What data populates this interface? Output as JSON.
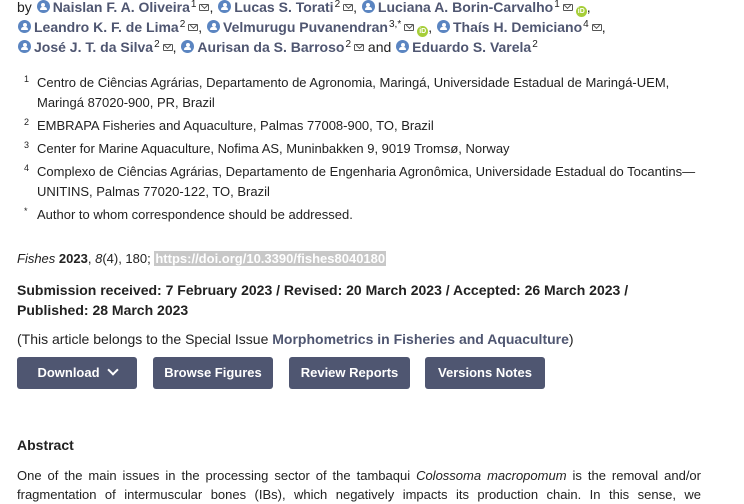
{
  "authors": {
    "by": "by",
    "list": [
      {
        "name": "Naislan F. A. Oliveira",
        "sup": "1"
      },
      {
        "name": "Lucas S. Torati",
        "sup": "2"
      },
      {
        "name": "Luciana A. Borin-Carvalho",
        "sup": "1"
      },
      {
        "name": "Leandro K. F. de Lima",
        "sup": "2"
      },
      {
        "name": "Velmurugu Puvanendran",
        "sup": "3,*"
      },
      {
        "name": "Thaís H. Demiciano",
        "sup": "4"
      },
      {
        "name": "José J. T. da Silva",
        "sup": "2"
      },
      {
        "name": "Aurisan da S. Barroso",
        "sup": "2"
      },
      {
        "name": "Eduardo S. Varela",
        "sup": "2"
      }
    ],
    "and": "and",
    "orcid_text": "iD"
  },
  "affiliations": [
    {
      "num": "1",
      "text": "Centro de Ciências Agrárias, Departamento de Agronomia, Maringá, Universidade Estadual de Maringá-UEM, Maringá 87020-900, PR, Brazil"
    },
    {
      "num": "2",
      "text": "EMBRAPA Fisheries and Aquaculture, Palmas 77008-900, TO, Brazil"
    },
    {
      "num": "3",
      "text": "Center for Marine Aquaculture, Nofima AS, Muninbakken 9, 9019 Tromsø, Norway"
    },
    {
      "num": "4",
      "text": "Complexo de Ciências Agrárias, Departamento de Engenharia Agronômica, Universidade Estadual do Tocantins—UNITINS, Palmas 77020-122, TO, Brazil"
    },
    {
      "num": "*",
      "text": "Author to whom correspondence should be addressed."
    }
  ],
  "citation": {
    "journal": "Fishes",
    "year": "2023",
    "volume": "8",
    "issue_pages": "(4), 180;",
    "doi": "https://doi.org/10.3390/fishes8040180"
  },
  "dates": {
    "line1": "Submission received: 7 February 2023 / Revised: 20 March 2023 / Accepted: 26 March 2023 /",
    "line2": "Published: 28 March 2023"
  },
  "special_issue": {
    "prefix": "(This article belongs to the Special Issue ",
    "link": "Morphometrics in Fisheries and Aquaculture",
    "suffix": ")"
  },
  "buttons": {
    "download": "Download",
    "browse_figures": "Browse Figures",
    "review_reports": "Review Reports",
    "versions_notes": "Versions Notes"
  },
  "abstract": {
    "title": "Abstract",
    "line1_pre": "One of the main issues in the processing sector of the tambaqui ",
    "line1_species": "Colossoma macropomum",
    "line1_post": " is the removal and/or",
    "line2": "fragmentation of intermuscular bones (IBs), which negatively impacts its production chain. In this sense, we"
  },
  "colors": {
    "accent": "#4f5671",
    "author_icon": "#5b85c1",
    "orcid": "#a6ce39",
    "doi_highlight": "#c8c8c8"
  }
}
